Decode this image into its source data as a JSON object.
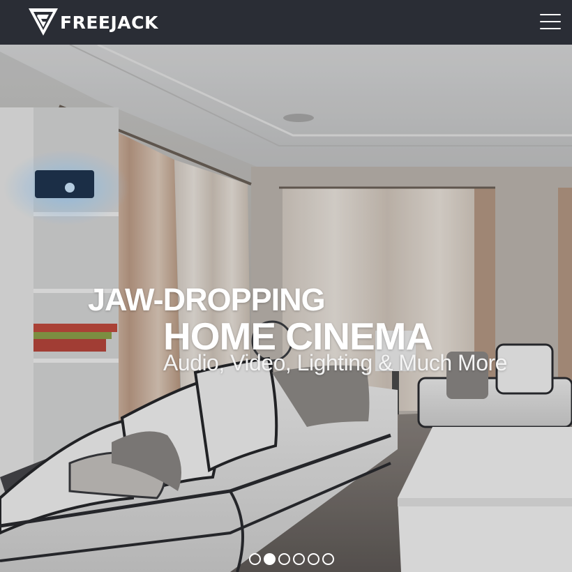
{
  "brand": {
    "name": "FREEJACK",
    "logo_icon": "freejack-logo-icon"
  },
  "nav": {
    "menu_icon": "hamburger-menu-icon"
  },
  "hero": {
    "line1": "JAW-DROPPING",
    "line2": "HOME CINEMA",
    "line3": "Audio, Video, Lighting & Much More",
    "image": "living-room-home-cinema-photo"
  },
  "carousel": {
    "slide_count": 6,
    "active_index": 1
  },
  "colors": {
    "topbar": "#2a2d35",
    "text": "#ffffff"
  }
}
